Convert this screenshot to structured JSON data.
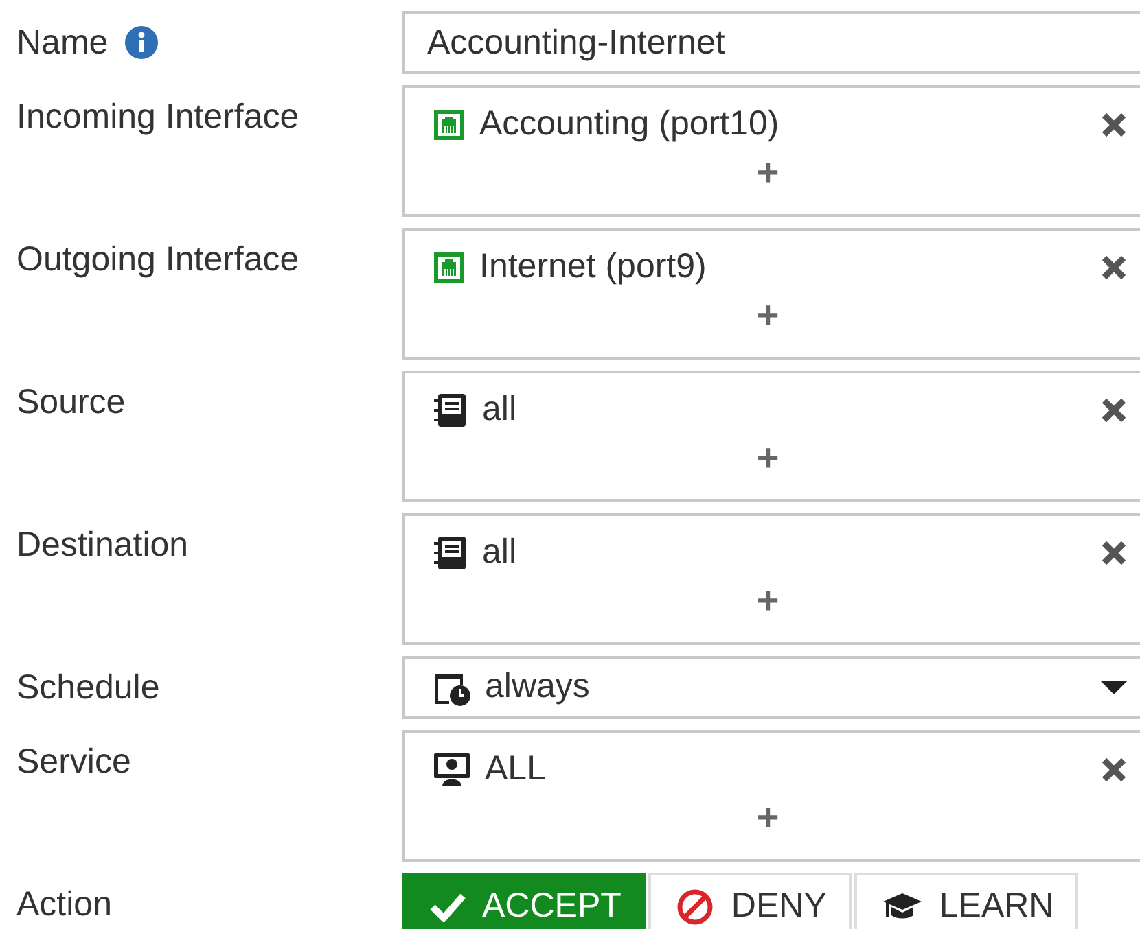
{
  "fields": [
    {
      "label": "Name",
      "info": true,
      "kind": "text",
      "value": "Accounting-Internet"
    },
    {
      "label": "Incoming Interface",
      "kind": "multi",
      "entries": [
        {
          "kind": "port",
          "text": "Accounting (port10)"
        }
      ],
      "add": "+"
    },
    {
      "label": "Outgoing Interface",
      "kind": "multi",
      "entries": [
        {
          "kind": "port",
          "text": "Internet (port9)"
        }
      ],
      "add": "+"
    },
    {
      "label": "Source",
      "kind": "multi",
      "entries": [
        {
          "kind": "address",
          "text": "all"
        }
      ],
      "add": "+"
    },
    {
      "label": "Destination",
      "kind": "multi",
      "entries": [
        {
          "kind": "address",
          "text": "all"
        }
      ],
      "add": "+"
    },
    {
      "label": "Schedule",
      "kind": "select",
      "value": "always"
    },
    {
      "label": "Service",
      "kind": "multi",
      "entries": [
        {
          "kind": "service",
          "text": "ALL"
        }
      ],
      "add": "+"
    },
    {
      "label": "Action",
      "kind": "toggle",
      "options": [
        {
          "kind": "accept",
          "text": "ACCEPT",
          "selected": true
        },
        {
          "kind": "deny",
          "text": "DENY",
          "selected": false
        },
        {
          "kind": "learn",
          "text": "LEARN",
          "selected": false
        }
      ]
    }
  ]
}
